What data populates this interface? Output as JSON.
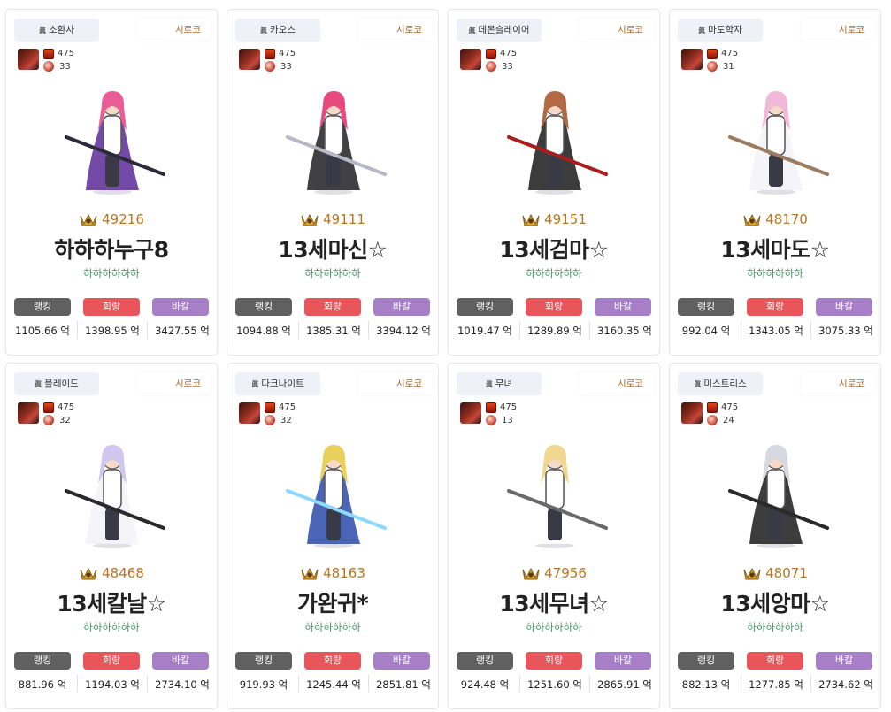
{
  "icons": {
    "job": "job-mark-icon",
    "server": "server-label",
    "score": "trophy-icon",
    "fame": "gear-icon",
    "level": "pet-icon"
  },
  "colors": {
    "score": "#b8741f",
    "guild": "#4f8f6e",
    "ranking_tag": "#606060",
    "recovery_tag": "#e8555a",
    "buff_tag": "#a67fc6",
    "server": "#a66c2e"
  },
  "labels": {
    "job_mark": "眞",
    "tag_ranking": "랭킹",
    "tag_recovery": "회랑",
    "tag_buff": "바칼"
  },
  "cards": [
    {
      "job": "소환사",
      "server": "시로코",
      "fame": "475",
      "level": "33",
      "score": "49216",
      "name": "하하하누구8",
      "guild": "하하하하하하",
      "stat1": "1105.66 억",
      "stat2": "1398.95 억",
      "stat3": "3427.55 억"
    },
    {
      "job": "카오스",
      "server": "시로코",
      "fame": "475",
      "level": "33",
      "score": "49111",
      "name": "13세마신☆",
      "guild": "하하하하하하",
      "stat1": "1094.88 억",
      "stat2": "1385.31 억",
      "stat3": "3394.12 억"
    },
    {
      "job": "데몬슬레이어",
      "server": "시로코",
      "fame": "475",
      "level": "33",
      "score": "49151",
      "name": "13세검마☆",
      "guild": "하하하하하하",
      "stat1": "1019.47 억",
      "stat2": "1289.89 억",
      "stat3": "3160.35 억"
    },
    {
      "job": "마도학자",
      "server": "시로코",
      "fame": "475",
      "level": "31",
      "score": "48170",
      "name": "13세마도☆",
      "guild": "하하하하하하",
      "stat1": "992.04 억",
      "stat2": "1343.05 억",
      "stat3": "3075.33 억"
    },
    {
      "job": "블레이드",
      "server": "시로코",
      "fame": "475",
      "level": "32",
      "score": "48468",
      "name": "13세칼날☆",
      "guild": "하하하하하하",
      "stat1": "881.96 억",
      "stat2": "1194.03 억",
      "stat3": "2734.10 억"
    },
    {
      "job": "다크나이트",
      "server": "시로코",
      "fame": "475",
      "level": "32",
      "score": "48163",
      "name": "가완귀*",
      "guild": "하하하하하하",
      "stat1": "919.93 억",
      "stat2": "1245.44 억",
      "stat3": "2851.81 억"
    },
    {
      "job": "무녀",
      "server": "시로코",
      "fame": "475",
      "level": "13",
      "score": "47956",
      "name": "13세무녀☆",
      "guild": "하하하하하하",
      "stat1": "924.48 억",
      "stat2": "1251.60 억",
      "stat3": "2865.91 억"
    },
    {
      "job": "미스트리스",
      "server": "시로코",
      "fame": "475",
      "level": "24",
      "score": "48071",
      "name": "13세앙마☆",
      "guild": "하하하하하하",
      "stat1": "882.13 억",
      "stat2": "1277.85 억",
      "stat3": "2734.62 억"
    }
  ]
}
